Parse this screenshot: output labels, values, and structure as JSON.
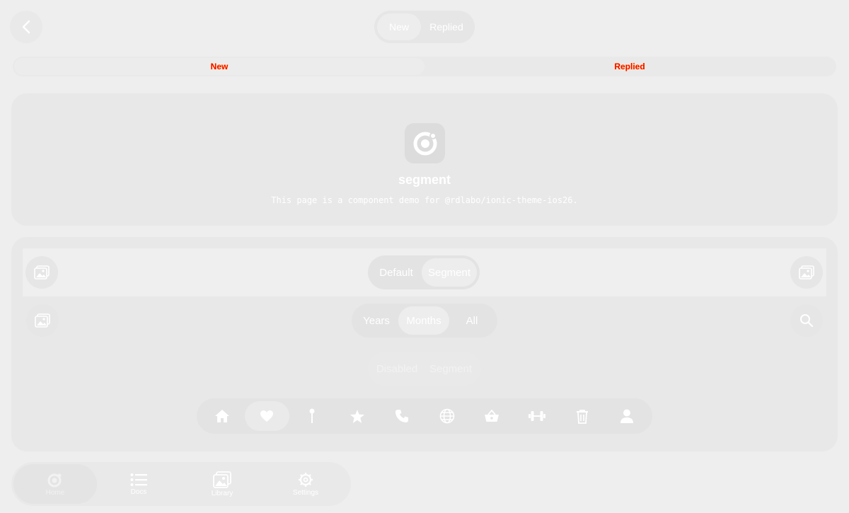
{
  "header": {
    "back_icon": "chevron-back-icon",
    "segment": {
      "items": [
        {
          "label": "New",
          "active": true
        },
        {
          "label": "Replied",
          "active": false
        }
      ]
    }
  },
  "wide_segment": {
    "items": [
      {
        "label": "New",
        "active": true
      },
      {
        "label": "Replied",
        "active": false
      }
    ]
  },
  "intro": {
    "logo_icon": "ionic-logo-icon",
    "title": "segment",
    "description": "This page is a component demo for @rdlabo/ionic-theme-ios26."
  },
  "demo": {
    "toolbar": {
      "start_icon": "image-icon",
      "end_icon": "image-icon",
      "segment": [
        {
          "label": "Default",
          "active": false
        },
        {
          "label": "Segment",
          "active": true
        }
      ]
    },
    "row2": {
      "start_icon": "image-icon",
      "end_icon": "search-icon",
      "segment": [
        {
          "label": "Years",
          "active": false
        },
        {
          "label": "Months",
          "active": true
        },
        {
          "label": "All",
          "active": false
        }
      ]
    },
    "disabled_segment": [
      {
        "label": "Disabled",
        "active": false
      },
      {
        "label": "Segment",
        "active": true
      }
    ],
    "icon_segment": [
      "home-icon",
      "heart-icon",
      "pin-icon",
      "star-icon",
      "call-icon",
      "globe-icon",
      "basket-icon",
      "barbell-icon",
      "trash-icon",
      "person-icon"
    ]
  },
  "tabbar": {
    "tabs": [
      {
        "label": "Home",
        "icon": "ionic-logo-icon",
        "active": true
      },
      {
        "label": "Docs",
        "icon": "list-icon",
        "active": false
      },
      {
        "label": "Library",
        "icon": "images-icon",
        "active": false
      },
      {
        "label": "Settings",
        "icon": "settings-icon",
        "active": false
      }
    ]
  },
  "colors": {
    "background": "#eeeeee",
    "card": "#e8e8e8",
    "text": "#ffffff",
    "highlight_text": "#ff0000"
  }
}
